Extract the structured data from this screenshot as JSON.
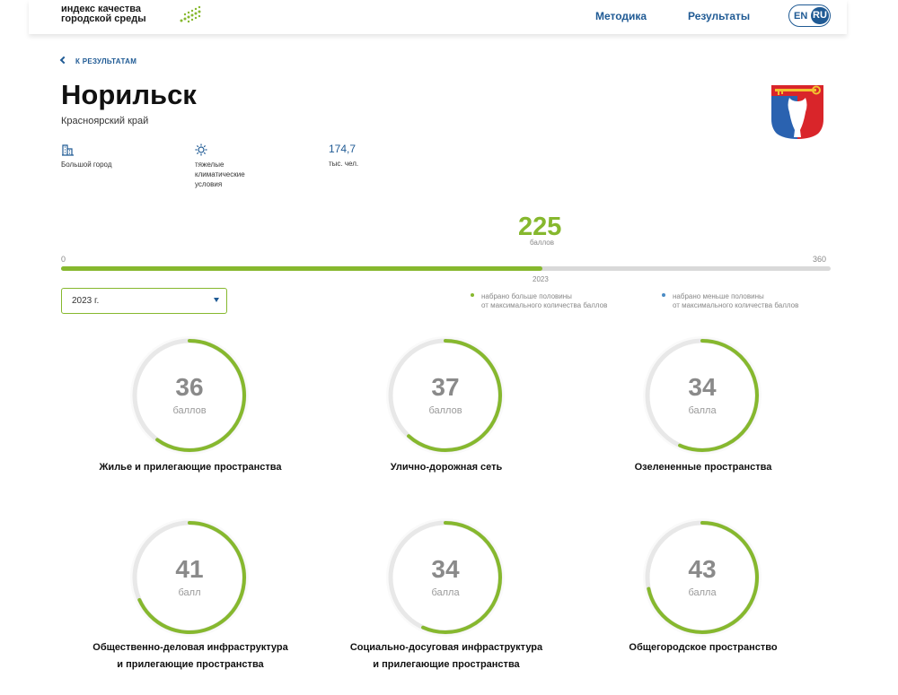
{
  "header": {
    "logo_line1": "индекс качества",
    "logo_line2": "городской среды",
    "nav": {
      "method": "Методика",
      "results": "Результаты"
    },
    "lang": {
      "en": "EN",
      "ru": "RU"
    }
  },
  "back_link": "К РЕЗУЛЬТАТАМ",
  "city": {
    "name": "Норильск",
    "region": "Красноярский край"
  },
  "info": {
    "size": "Большой город",
    "climate_1": "тяжелые",
    "climate_2": "климатические",
    "climate_3": "условия",
    "population": "174,7",
    "population_unit": "тыс. чел."
  },
  "total": {
    "score": "225",
    "unit": "баллов",
    "min": "0",
    "max": "360",
    "year": "2023",
    "fraction": 0.625
  },
  "year_select": {
    "value": "2023 г."
  },
  "legend": {
    "more_1": "набрано больше половины",
    "more_2": "от максимального количества баллов",
    "less_1": "набрано меньше половины",
    "less_2": "от максимального количества баллов",
    "more_color": "#86b82e",
    "less_color": "#4a8bc4"
  },
  "categories": [
    {
      "score": "36",
      "unit": "баллов",
      "title_1": "Жилье и прилегающие пространства",
      "title_2": "",
      "fraction": 0.6
    },
    {
      "score": "37",
      "unit": "баллов",
      "title_1": "Улично-дорожная сеть",
      "title_2": "",
      "fraction": 0.617
    },
    {
      "score": "34",
      "unit": "балла",
      "title_1": "Озелененные пространства",
      "title_2": "",
      "fraction": 0.567
    },
    {
      "score": "41",
      "unit": "балл",
      "title_1": "Общественно-деловая инфраструктура",
      "title_2": "и прилегающие пространства",
      "fraction": 0.683
    },
    {
      "score": "34",
      "unit": "балла",
      "title_1": "Социально-досуговая инфраструктура",
      "title_2": "и прилегающие пространства",
      "fraction": 0.567
    },
    {
      "score": "43",
      "unit": "балла",
      "title_1": "Общегородское пространство",
      "title_2": "",
      "fraction": 0.717
    }
  ],
  "colors": {
    "accent": "#86b82e",
    "brand": "#1f5a94",
    "track": "#e8e8e8"
  }
}
